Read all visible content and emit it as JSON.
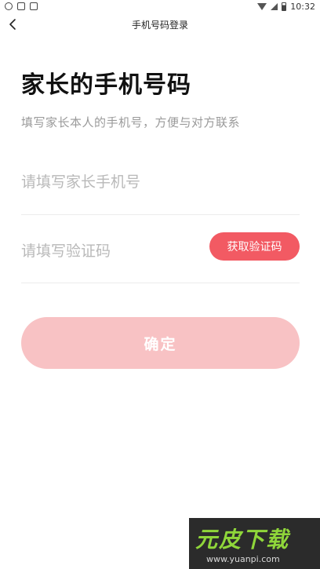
{
  "status_bar": {
    "time": "10:32"
  },
  "nav": {
    "title": "手机号码登录"
  },
  "page": {
    "title": "家长的手机号码",
    "subtitle": "填写家长本人的手机号，方便与对方联系"
  },
  "phone_input": {
    "placeholder": "请填写家长手机号"
  },
  "code_input": {
    "placeholder": "请填写验证码"
  },
  "code_button": {
    "label": "获取验证码"
  },
  "confirm_button": {
    "label": "确定"
  },
  "watermark": {
    "logo": "元皮下载",
    "url": "www.yuanpi.com"
  },
  "colors": {
    "accent": "#f25a63",
    "confirm_disabled": "#f8c2c4"
  }
}
